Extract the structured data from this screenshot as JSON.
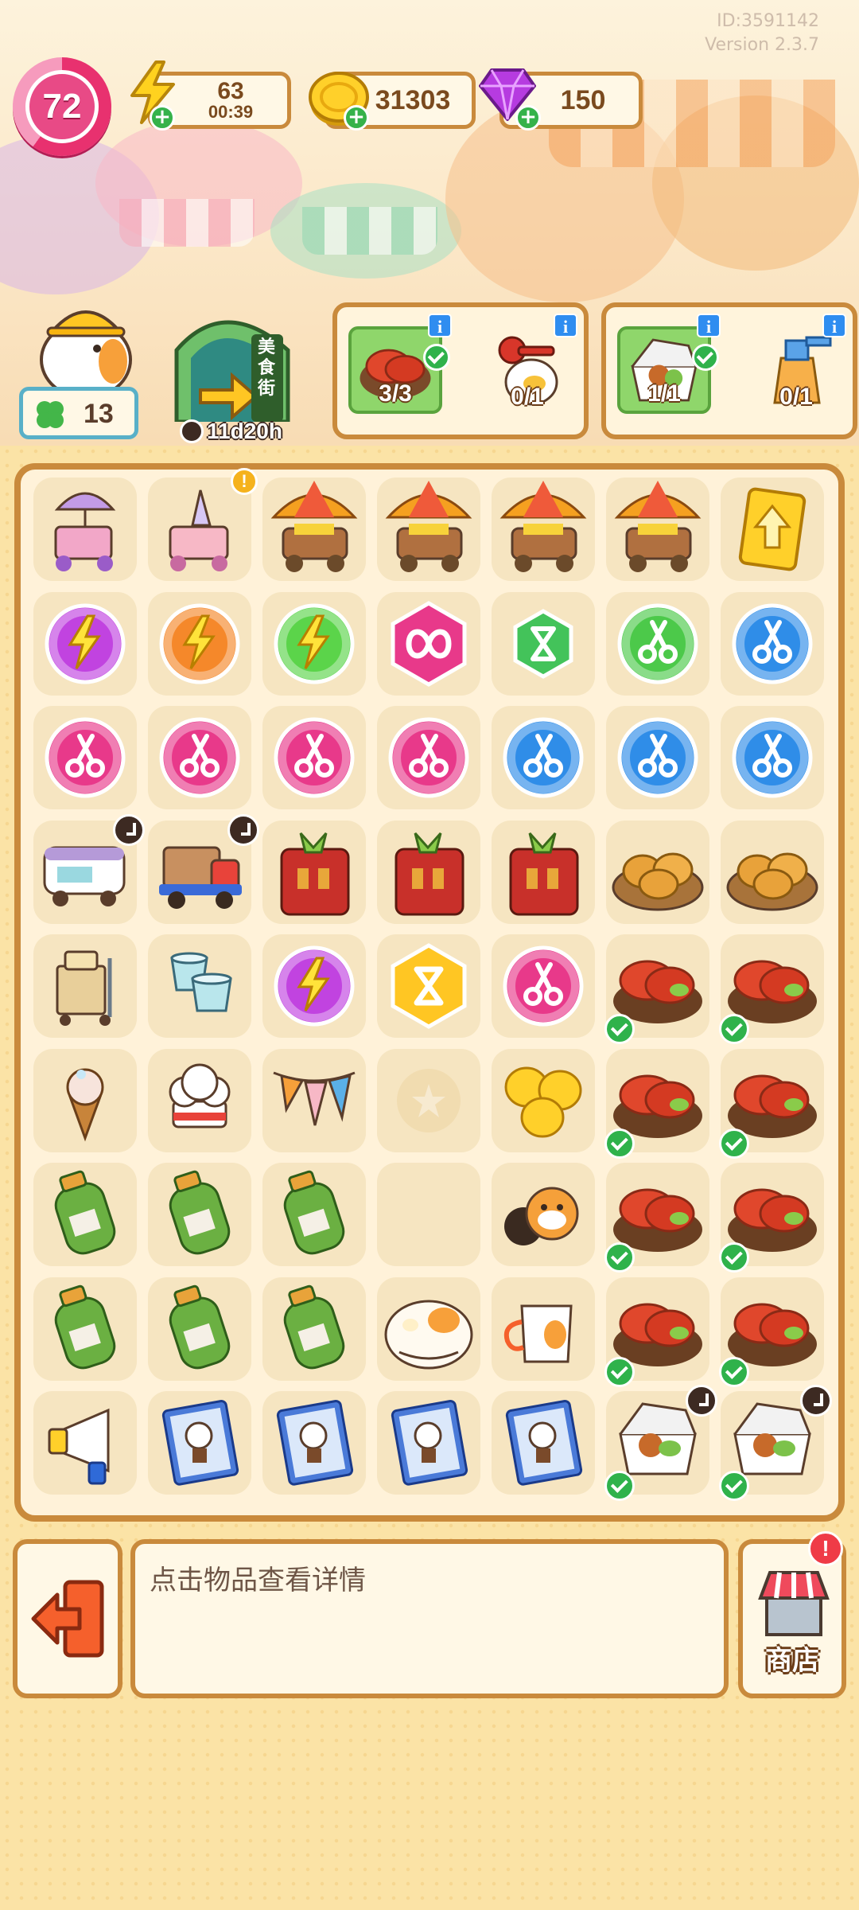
{
  "header": {
    "id_text": "ID:3591142",
    "version_text": "Version 2.3.7",
    "level": "72",
    "energy": {
      "value": "63",
      "timer": "00:39"
    },
    "coins": {
      "value": "31303"
    },
    "gems": {
      "value": "150"
    }
  },
  "left_info": {
    "clover_count": "13",
    "gate_label": "美食街",
    "gate_timer": "11d20h"
  },
  "orders": [
    {
      "items": [
        {
          "icon": "crayfish-plate-icon",
          "count": "3/3",
          "done": true
        },
        {
          "icon": "key-duck-icon",
          "count": "0/1",
          "done": false
        }
      ]
    },
    {
      "items": [
        {
          "icon": "takeout-box-icon",
          "count": "1/1",
          "done": true
        },
        {
          "icon": "spray-bottle-icon",
          "count": "0/1",
          "done": false
        }
      ]
    }
  ],
  "board": {
    "rows": [
      [
        "parasol-cart",
        "icecream-cart",
        "umbrella-bbq-cart",
        "umbrella-bbq-cart",
        "umbrella-bbq-cart",
        "umbrella-bbq-cart",
        "upgrade-card"
      ],
      [
        "energy-bubble-purple",
        "energy-bubble-orange",
        "energy-bubble-green",
        "infinity-hexagon",
        "hourglass-hexagon-green",
        "scissors-bubble-green",
        "scissors-bubble-blue"
      ],
      [
        "scissors-bubble-pink",
        "scissors-bubble-pink",
        "scissors-bubble-pink",
        "scissors-bubble-pink",
        "scissors-bubble-blue",
        "scissors-bubble-blue",
        "scissors-bubble-blue"
      ],
      [
        "food-truck",
        "delivery-truck",
        "toaster-box",
        "toaster-box",
        "toaster-box",
        "pie-basket",
        "pie-basket"
      ],
      [
        "luggage-cart",
        "teacups",
        "energy-bubble-purple",
        "hourglass-hexagon-gold",
        "scissors-bubble-pink",
        "crayfish-plate",
        "crayfish-plate"
      ],
      [
        "icecream-cone",
        "chef-hat",
        "bunting-flags",
        "empty-slot",
        "coin-pile",
        "crayfish-plate",
        "crayfish-plate"
      ],
      [
        "gas-cylinder",
        "gas-cylinder",
        "gas-cylinder",
        "empty",
        "raccoon-mascot",
        "crayfish-plate",
        "crayfish-plate"
      ],
      [
        "gas-cylinder",
        "gas-cylinder",
        "gas-cylinder",
        "duck-bun",
        "duck-mug",
        "crayfish-plate",
        "crayfish-plate"
      ],
      [
        "megaphone",
        "duck-poster",
        "duck-poster",
        "duck-poster",
        "duck-poster",
        "takeout-box",
        "takeout-box"
      ]
    ]
  },
  "bottom": {
    "hint_text": "点击物品查看详情",
    "shop_label": "商店",
    "shop_badge": "!"
  }
}
